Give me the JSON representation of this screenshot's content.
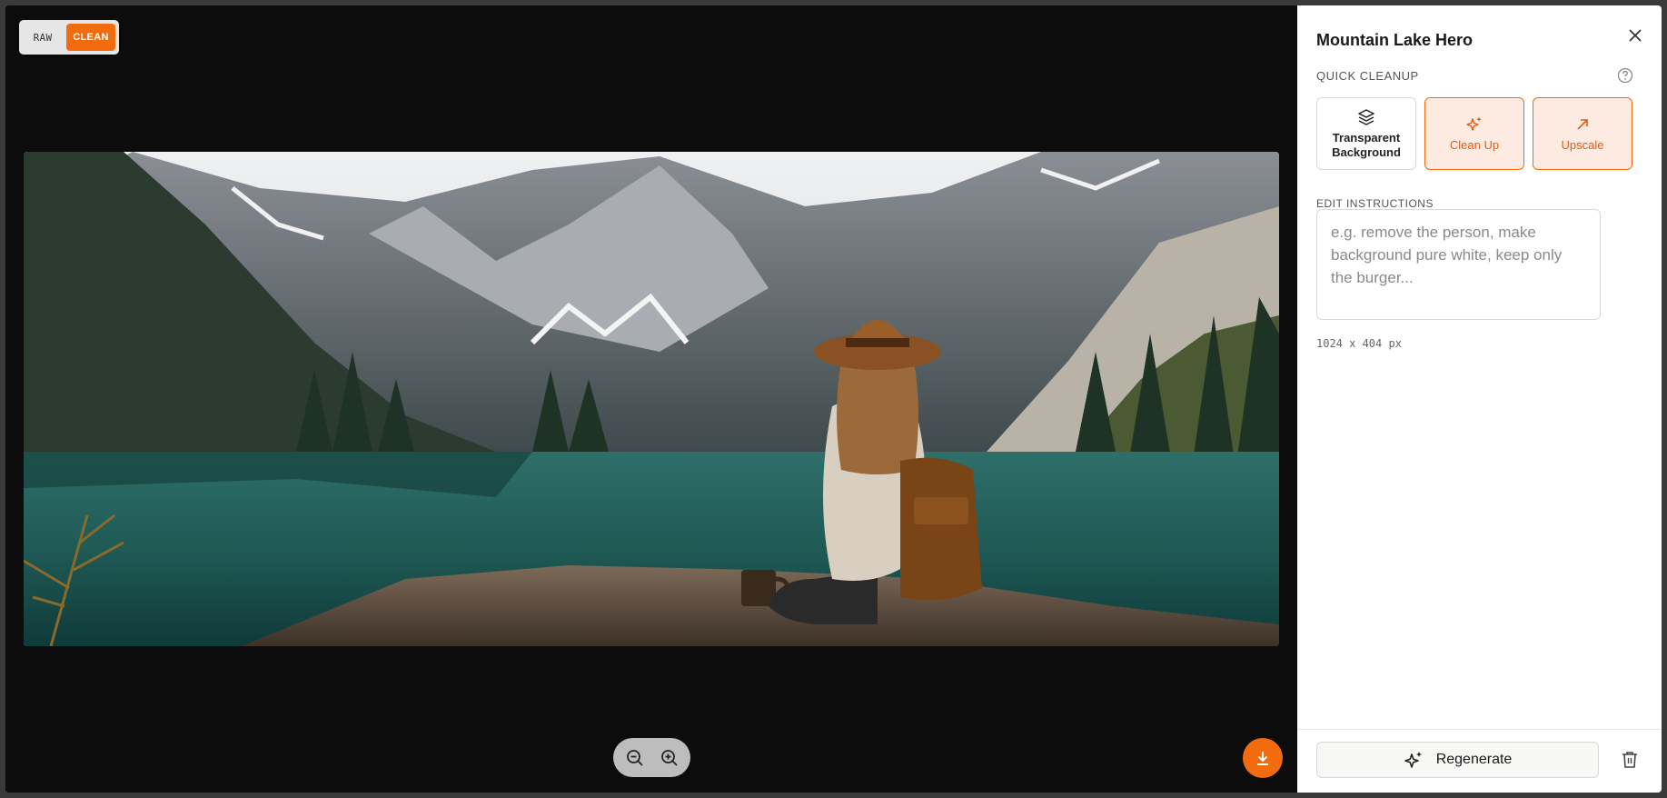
{
  "viewer": {
    "toggle": {
      "raw": "RAW",
      "clean": "CLEAN",
      "active": "CLEAN"
    },
    "image_alt": "Woman in brown hat and backpack sitting on rock by mountain lake",
    "icons": {
      "zoom_out": "zoom-out-icon",
      "zoom_in": "zoom-in-icon",
      "download": "download-icon"
    }
  },
  "panel": {
    "title": "Mountain Lake Hero",
    "quick_cleanup_label": "QUICK CLEANUP",
    "actions": [
      {
        "label_line1": "Transparent",
        "label_line2": "Background",
        "icon": "layers-icon",
        "active": false
      },
      {
        "label_line1": "Clean Up",
        "label_line2": "",
        "icon": "sparkle-icon",
        "active": true
      },
      {
        "label_line1": "Upscale",
        "label_line2": "",
        "icon": "arrow-up-right-icon",
        "active": true
      }
    ],
    "edit_instructions_label": "EDIT INSTRUCTIONS",
    "edit_placeholder": "e.g. remove the person, make background pure white, keep only the burger...",
    "dimensions": "1024 x 404 px",
    "regenerate_label": "Regenerate"
  },
  "colors": {
    "accent": "#f26b0f",
    "accent_bg": "#fdebe2"
  }
}
